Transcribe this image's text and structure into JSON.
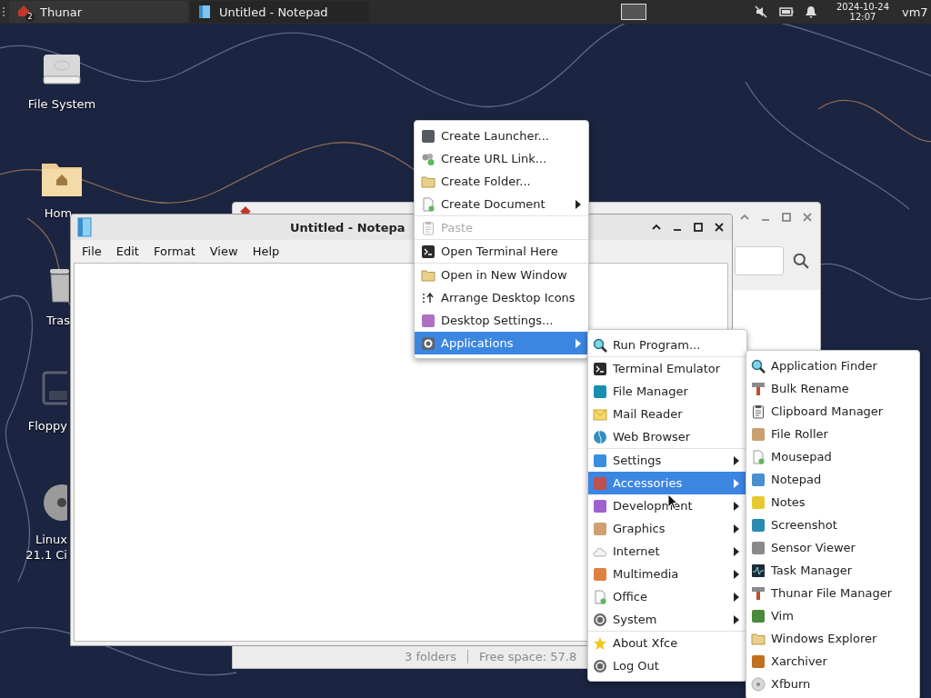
{
  "taskbar": {
    "tasks": [
      {
        "label": "Thunar",
        "badge": "2",
        "selected": false
      },
      {
        "label": "Untitled - Notepad",
        "selected": true
      }
    ],
    "clock": {
      "date": "2024-10-24",
      "time": "12:07"
    },
    "user": "vm7"
  },
  "desktop_icons": [
    {
      "kind": "drive",
      "label": [
        "File System"
      ]
    },
    {
      "kind": "home",
      "label": [
        "Hom"
      ]
    },
    {
      "kind": "trash",
      "label": [
        "Tras"
      ]
    },
    {
      "kind": "floppy",
      "label": [
        "Floppy"
      ]
    },
    {
      "kind": "disc",
      "label": [
        "Linux",
        "21.1 Ci"
      ]
    }
  ],
  "thunar_window": {
    "status_bar": [
      "3 folders",
      "Free space: 57.8"
    ]
  },
  "notepad_window": {
    "title": "Untitled - Notepa",
    "menu": [
      "File",
      "Edit",
      "Format",
      "View",
      "Help"
    ]
  },
  "context_menu": {
    "items": [
      {
        "kind": "item",
        "label": "Create Launcher...",
        "submenu": false,
        "disabled": false,
        "selected": false
      },
      {
        "kind": "item",
        "label": "Create URL Link...",
        "submenu": false,
        "disabled": false,
        "selected": false
      },
      {
        "kind": "item",
        "label": "Create Folder...",
        "submenu": false,
        "disabled": false,
        "selected": false
      },
      {
        "kind": "item",
        "label": "Create Document",
        "submenu": true,
        "disabled": false,
        "selected": false
      },
      {
        "kind": "separator"
      },
      {
        "kind": "item",
        "label": "Paste",
        "submenu": false,
        "disabled": true,
        "selected": false
      },
      {
        "kind": "separator"
      },
      {
        "kind": "item",
        "label": "Open Terminal Here",
        "submenu": false,
        "disabled": false,
        "selected": false
      },
      {
        "kind": "separator"
      },
      {
        "kind": "item",
        "label": "Open in New Window",
        "submenu": false,
        "disabled": false,
        "selected": false
      },
      {
        "kind": "item",
        "label": "Arrange Desktop Icons",
        "submenu": false,
        "disabled": false,
        "selected": false
      },
      {
        "kind": "item",
        "label": "Desktop Settings...",
        "submenu": false,
        "disabled": false,
        "selected": false
      },
      {
        "kind": "item",
        "label": "Applications",
        "submenu": true,
        "disabled": false,
        "selected": true
      }
    ]
  },
  "applications_menu": {
    "items": [
      {
        "kind": "item",
        "label": "Run Program...",
        "submenu": false,
        "selected": false
      },
      {
        "kind": "separator"
      },
      {
        "kind": "item",
        "label": "Terminal Emulator",
        "submenu": false,
        "selected": false
      },
      {
        "kind": "item",
        "label": "File Manager",
        "submenu": false,
        "selected": false
      },
      {
        "kind": "item",
        "label": "Mail Reader",
        "submenu": false,
        "selected": false
      },
      {
        "kind": "item",
        "label": "Web Browser",
        "submenu": false,
        "selected": false
      },
      {
        "kind": "separator"
      },
      {
        "kind": "item",
        "label": "Settings",
        "submenu": true,
        "selected": false
      },
      {
        "kind": "item",
        "label": "Accessories",
        "submenu": true,
        "selected": true
      },
      {
        "kind": "item",
        "label": "Development",
        "submenu": true,
        "selected": false
      },
      {
        "kind": "item",
        "label": "Graphics",
        "submenu": true,
        "selected": false
      },
      {
        "kind": "item",
        "label": "Internet",
        "submenu": true,
        "selected": false
      },
      {
        "kind": "item",
        "label": "Multimedia",
        "submenu": true,
        "selected": false
      },
      {
        "kind": "item",
        "label": "Office",
        "submenu": true,
        "selected": false
      },
      {
        "kind": "item",
        "label": "System",
        "submenu": true,
        "selected": false
      },
      {
        "kind": "separator"
      },
      {
        "kind": "item",
        "label": "About Xfce",
        "submenu": false,
        "selected": false
      },
      {
        "kind": "item",
        "label": "Log Out",
        "submenu": false,
        "selected": false
      }
    ]
  },
  "accessories_menu": {
    "items": [
      {
        "kind": "item",
        "label": "Application Finder",
        "submenu": false,
        "selected": false
      },
      {
        "kind": "item",
        "label": "Bulk Rename",
        "submenu": false,
        "selected": false
      },
      {
        "kind": "item",
        "label": "Clipboard Manager",
        "submenu": false,
        "selected": false
      },
      {
        "kind": "item",
        "label": "File Roller",
        "submenu": false,
        "selected": false
      },
      {
        "kind": "item",
        "label": "Mousepad",
        "submenu": false,
        "selected": false
      },
      {
        "kind": "item",
        "label": "Notepad",
        "submenu": false,
        "selected": false
      },
      {
        "kind": "item",
        "label": "Notes",
        "submenu": false,
        "selected": false
      },
      {
        "kind": "item",
        "label": "Screenshot",
        "submenu": false,
        "selected": false
      },
      {
        "kind": "item",
        "label": "Sensor Viewer",
        "submenu": false,
        "selected": false
      },
      {
        "kind": "item",
        "label": "Task Manager",
        "submenu": false,
        "selected": false
      },
      {
        "kind": "item",
        "label": "Thunar File Manager",
        "submenu": false,
        "selected": false
      },
      {
        "kind": "item",
        "label": "Vim",
        "submenu": false,
        "selected": false
      },
      {
        "kind": "item",
        "label": "Windows Explorer",
        "submenu": false,
        "selected": false
      },
      {
        "kind": "item",
        "label": "Xarchiver",
        "submenu": false,
        "selected": false
      },
      {
        "kind": "item",
        "label": "Xfburn",
        "submenu": false,
        "selected": false
      }
    ]
  }
}
